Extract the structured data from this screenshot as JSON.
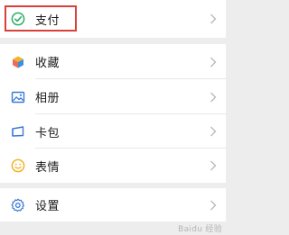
{
  "pay": {
    "label": "支付",
    "icon": "wechat-pay-icon"
  },
  "main_items": [
    {
      "label": "收藏",
      "icon": "favorites-cube-icon"
    },
    {
      "label": "相册",
      "icon": "album-picture-icon"
    },
    {
      "label": "卡包",
      "icon": "card-wallet-icon"
    },
    {
      "label": "表情",
      "icon": "smiley-emoji-icon"
    }
  ],
  "settings": {
    "label": "设置",
    "icon": "gear-settings-icon"
  },
  "watermark": "Baidu 经验",
  "colors": {
    "background": "#ededed",
    "row": "#ffffff",
    "highlight": "#d9403a",
    "pay_green": "#2aae67",
    "settings_blue": "#3b7bd4",
    "smiley_yellow": "#f2b327"
  }
}
